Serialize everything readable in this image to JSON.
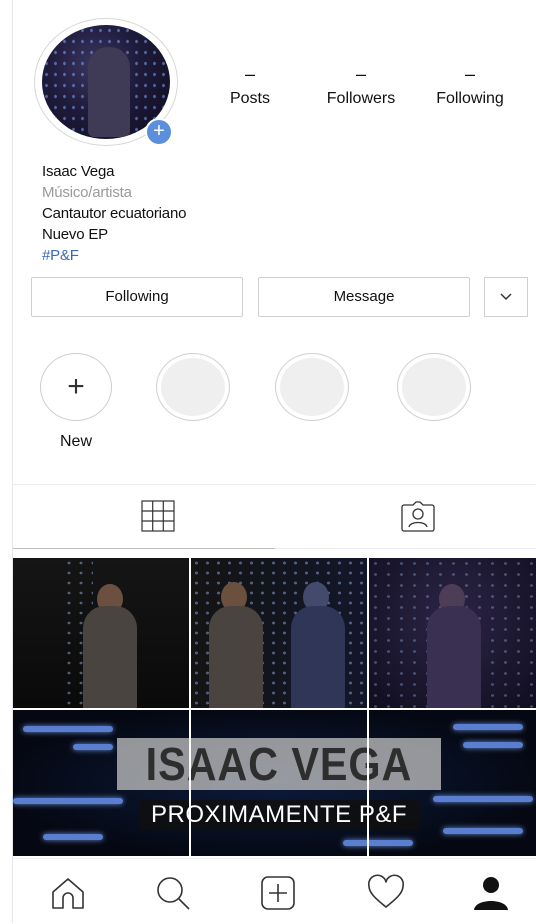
{
  "profile": {
    "name": "Isaac Vega",
    "category": "Músico/artista",
    "bio_line1": "Cantautor ecuatoriano",
    "bio_line2": "Nuevo EP",
    "hashtag": "#P&F",
    "add_story_icon": "plus-icon"
  },
  "stats": {
    "posts": {
      "value": "–",
      "label": "Posts"
    },
    "followers": {
      "value": "–",
      "label": "Followers"
    },
    "following": {
      "value": "–",
      "label": "Following"
    }
  },
  "actions": {
    "following_label": "Following",
    "message_label": "Message",
    "more_icon": "chevron-down-icon"
  },
  "highlights": {
    "new_label": "New",
    "empty_count_shown": 3
  },
  "tabs": {
    "grid_icon": "grid-icon",
    "tagged_icon": "tagged-icon",
    "active": "grid"
  },
  "posts_banner": {
    "title": "ISAAC VEGA",
    "subtitle": "PROXIMAMENTE P&F"
  },
  "bottom_nav": {
    "items": [
      "home-icon",
      "search-icon",
      "add-post-icon",
      "heart-icon",
      "profile-icon"
    ]
  },
  "colors": {
    "accent_blue": "#5b8edb",
    "hashtag_blue": "#3b68b3",
    "muted_text": "#9a9a9a"
  }
}
